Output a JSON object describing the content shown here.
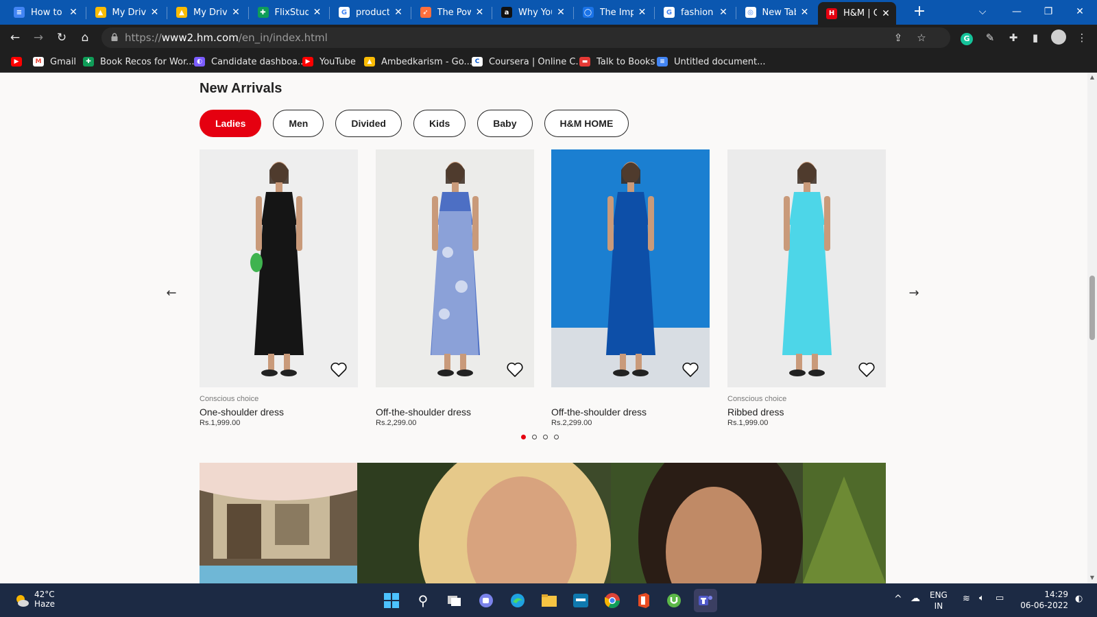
{
  "browser": {
    "tabs": [
      {
        "label": "How to le",
        "icon": "docs-icon",
        "color": "#4285f4"
      },
      {
        "label": "My Drive",
        "icon": "drive-icon",
        "color": "#fbbc04"
      },
      {
        "label": "My Drive",
        "icon": "drive-icon",
        "color": "#fbbc04"
      },
      {
        "label": "FlixStudio",
        "icon": "sheets-icon",
        "color": "#0f9d58"
      },
      {
        "label": "product r",
        "icon": "google-icon",
        "color": "#ffffff"
      },
      {
        "label": "The Powe",
        "icon": "rocket-icon",
        "color": "#ff6f3c"
      },
      {
        "label": "Why You",
        "icon": "amazon-icon",
        "color": "#111111"
      },
      {
        "label": "The Impo",
        "icon": "globe-icon",
        "color": "#1a73e8"
      },
      {
        "label": "fashion e",
        "icon": "google-icon",
        "color": "#ffffff"
      },
      {
        "label": "New Tab",
        "icon": "chrome-icon",
        "color": "#ffffff"
      },
      {
        "label": "H&M | O",
        "icon": "hm-icon",
        "color": "#e50010"
      }
    ],
    "url_prefix": "https://",
    "url_domain": "www2.hm.com",
    "url_path": "/en_in/index.html",
    "bookmarks": [
      {
        "label": "",
        "icon": "youtube-icon"
      },
      {
        "label": "Gmail",
        "icon": "gmail-icon"
      },
      {
        "label": "Book Recos for Wor...",
        "icon": "sheets-icon"
      },
      {
        "label": "Candidate dashboa...",
        "icon": "candidate-icon"
      },
      {
        "label": "YouTube",
        "icon": "youtube-icon"
      },
      {
        "label": "Ambedkarism - Go...",
        "icon": "drive-icon"
      },
      {
        "label": "Coursera | Online C...",
        "icon": "coursera-icon"
      },
      {
        "label": "Talk to Books",
        "icon": "talk-books-icon"
      },
      {
        "label": "Untitled document...",
        "icon": "docs-icon"
      }
    ]
  },
  "page": {
    "section_title": "New Arrivals",
    "filters": [
      "Ladies",
      "Men",
      "Divided",
      "Kids",
      "Baby",
      "H&M HOME"
    ],
    "active_filter": "Ladies",
    "products": [
      {
        "badge": "Conscious choice",
        "name": "One-shoulder dress",
        "price": "Rs.1,999.00",
        "bg": "#eeeeee",
        "dress": "#151515"
      },
      {
        "badge": "",
        "name": "Off-the-shoulder dress",
        "price": "Rs.2,299.00",
        "bg": "#ececea",
        "dress": "#4d6fc4"
      },
      {
        "badge": "",
        "name": "Off-the-shoulder dress",
        "price": "Rs.2,299.00",
        "bg": "#1b7fd1",
        "dress": "#0d4fa8"
      },
      {
        "badge": "Conscious choice",
        "name": "Ribbed dress",
        "price": "Rs.1,999.00",
        "bg": "#ebebeb",
        "dress": "#4dd6e8"
      }
    ],
    "carousel_pages": 4,
    "carousel_current": 1
  },
  "taskbar": {
    "temperature": "42°C",
    "weather": "Haze",
    "lang_top": "ENG",
    "lang_bottom": "IN",
    "time": "14:29",
    "date": "06-06-2022"
  },
  "colors": {
    "accent": "#e50010",
    "tab_strip": "#0b57b0",
    "toolbar": "#1f1f1f"
  }
}
